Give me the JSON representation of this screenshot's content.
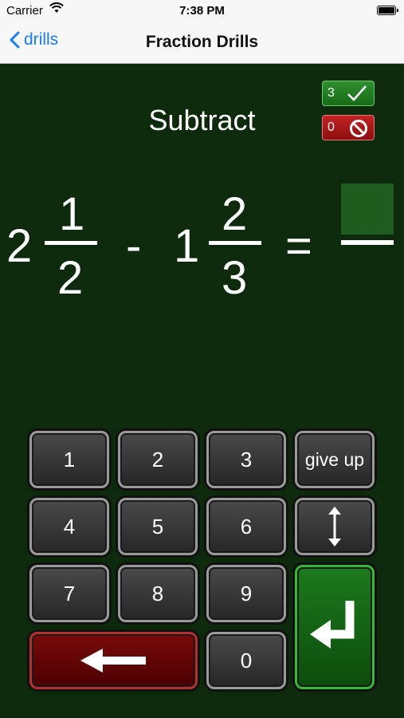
{
  "status_bar": {
    "carrier": "Carrier",
    "time": "7:38 PM"
  },
  "nav": {
    "back_label": "drills",
    "title": "Fraction Drills"
  },
  "drill": {
    "operation": "Subtract",
    "score": {
      "correct": "3",
      "wrong": "0"
    }
  },
  "problem": {
    "first": {
      "whole": "2",
      "numerator": "1",
      "denominator": "2"
    },
    "operator": "-",
    "second": {
      "whole": "1",
      "numerator": "2",
      "denominator": "3"
    },
    "equals": "="
  },
  "keypad": {
    "k1": "1",
    "k2": "2",
    "k3": "3",
    "k4": "4",
    "k5": "5",
    "k6": "6",
    "k7": "7",
    "k8": "8",
    "k9": "9",
    "k0": "0",
    "give_up": "give up"
  },
  "colors": {
    "background": "#0d2a0d",
    "correct_badge": "#2f8f2f",
    "wrong_badge": "#c42424",
    "nav_link": "#1a7cf5"
  },
  "icons": [
    "wifi-icon",
    "battery-icon",
    "chevron-left-icon",
    "checkmark-icon",
    "prohibited-icon",
    "vertical-arrows-icon",
    "left-arrow-icon",
    "return-arrow-icon"
  ]
}
